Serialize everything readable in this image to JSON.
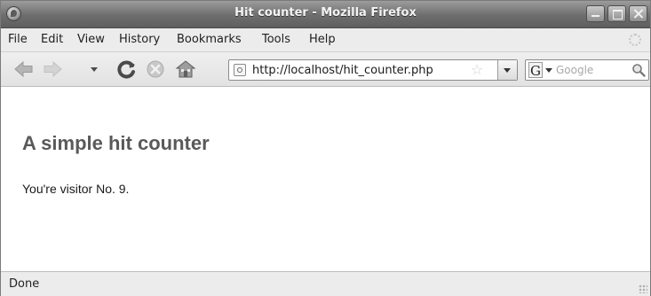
{
  "window": {
    "title": "Hit counter - Mozilla Firefox"
  },
  "menu": {
    "items": [
      "File",
      "Edit",
      "View",
      "History",
      "Bookmarks",
      "Tools",
      "Help"
    ]
  },
  "toolbar": {
    "icons": [
      "back-icon",
      "forward-icon",
      "history-dropdown-icon",
      "reload-icon",
      "stop-icon",
      "home-icon"
    ]
  },
  "urlbar": {
    "url": "http://localhost/hit_counter.php"
  },
  "search": {
    "engine": "G",
    "placeholder": "Google"
  },
  "page": {
    "heading": "A simple hit counter",
    "text": "You're visitor No. 9."
  },
  "status": {
    "text": "Done"
  }
}
